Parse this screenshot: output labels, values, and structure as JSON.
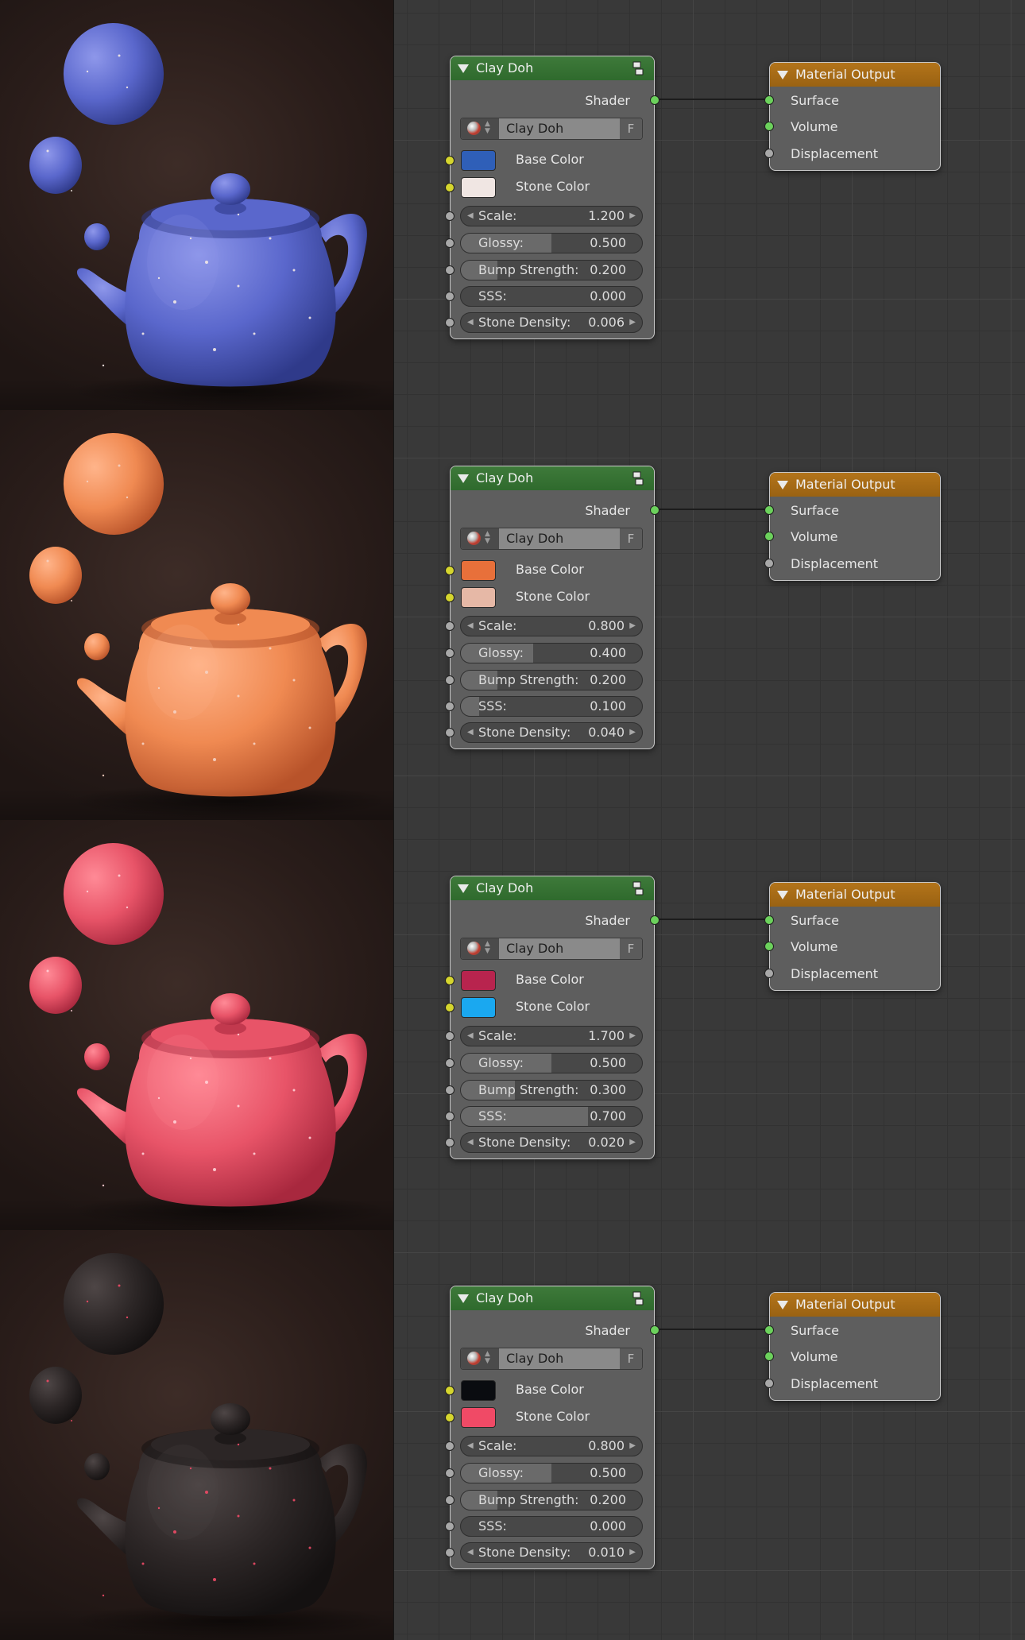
{
  "clay_node": {
    "title": "Clay Doh",
    "output_label": "Shader",
    "material_name": "Clay Doh",
    "fake_user_label": "F",
    "base_color_label": "Base Color",
    "stone_color_label": "Stone Color",
    "scale_label": "Scale:",
    "glossy_label": "Glossy:",
    "bump_label": "Bump Strength:",
    "sss_label": "SSS:",
    "density_label": "Stone Density:"
  },
  "output_node": {
    "title": "Material Output",
    "surface_label": "Surface",
    "volume_label": "Volume",
    "displacement_label": "Displacement"
  },
  "icons": [
    "collapse-triangle-icon",
    "node-group-icon",
    "material-sphere-icon",
    "arrow-left-icon",
    "arrow-right-icon"
  ],
  "colors": {
    "clay_header": "#2f6a2d",
    "output_header": "#9a6212",
    "socket_shader": "#6cd15c",
    "socket_color": "#d6d62e",
    "socket_value": "#a8a8a8"
  },
  "variants": [
    {
      "base_color": "#2f5fb8",
      "stone_color": "#f0e6e3",
      "scale": "1.200",
      "glossy": "0.500",
      "bump": "0.200",
      "sss": "0.000",
      "density": "0.006",
      "glossy_frac": 0.5,
      "bump_frac": 0.2,
      "sss_frac": 0.0,
      "clay_base": "#5a67cc",
      "clay_dark": "#2f3a8a",
      "clay_light": "#8e97ea",
      "speck": "#f3e9e5"
    },
    {
      "base_color": "#e8703a",
      "stone_color": "#e6b8a6",
      "scale": "0.800",
      "glossy": "0.400",
      "bump": "0.200",
      "sss": "0.100",
      "density": "0.040",
      "glossy_frac": 0.4,
      "bump_frac": 0.2,
      "sss_frac": 0.1,
      "clay_base": "#f08a52",
      "clay_dark": "#b8532a",
      "clay_light": "#ffb48a",
      "speck": "#f5d2c2"
    },
    {
      "base_color": "#b8244e",
      "stone_color": "#1aa8f0",
      "scale": "1.700",
      "glossy": "0.500",
      "bump": "0.300",
      "sss": "0.700",
      "density": "0.020",
      "glossy_frac": 0.5,
      "bump_frac": 0.3,
      "sss_frac": 0.7,
      "clay_base": "#e85468",
      "clay_dark": "#a8283e",
      "clay_light": "#ff8a96",
      "speck": "#ffd0d6"
    },
    {
      "base_color": "#0a0c10",
      "stone_color": "#f04a66",
      "scale": "0.800",
      "glossy": "0.500",
      "bump": "0.200",
      "sss": "0.000",
      "density": "0.010",
      "glossy_frac": 0.5,
      "bump_frac": 0.2,
      "sss_frac": 0.0,
      "clay_base": "#2c2626",
      "clay_dark": "#141111",
      "clay_light": "#4e4646",
      "speck": "#f04a66"
    }
  ]
}
